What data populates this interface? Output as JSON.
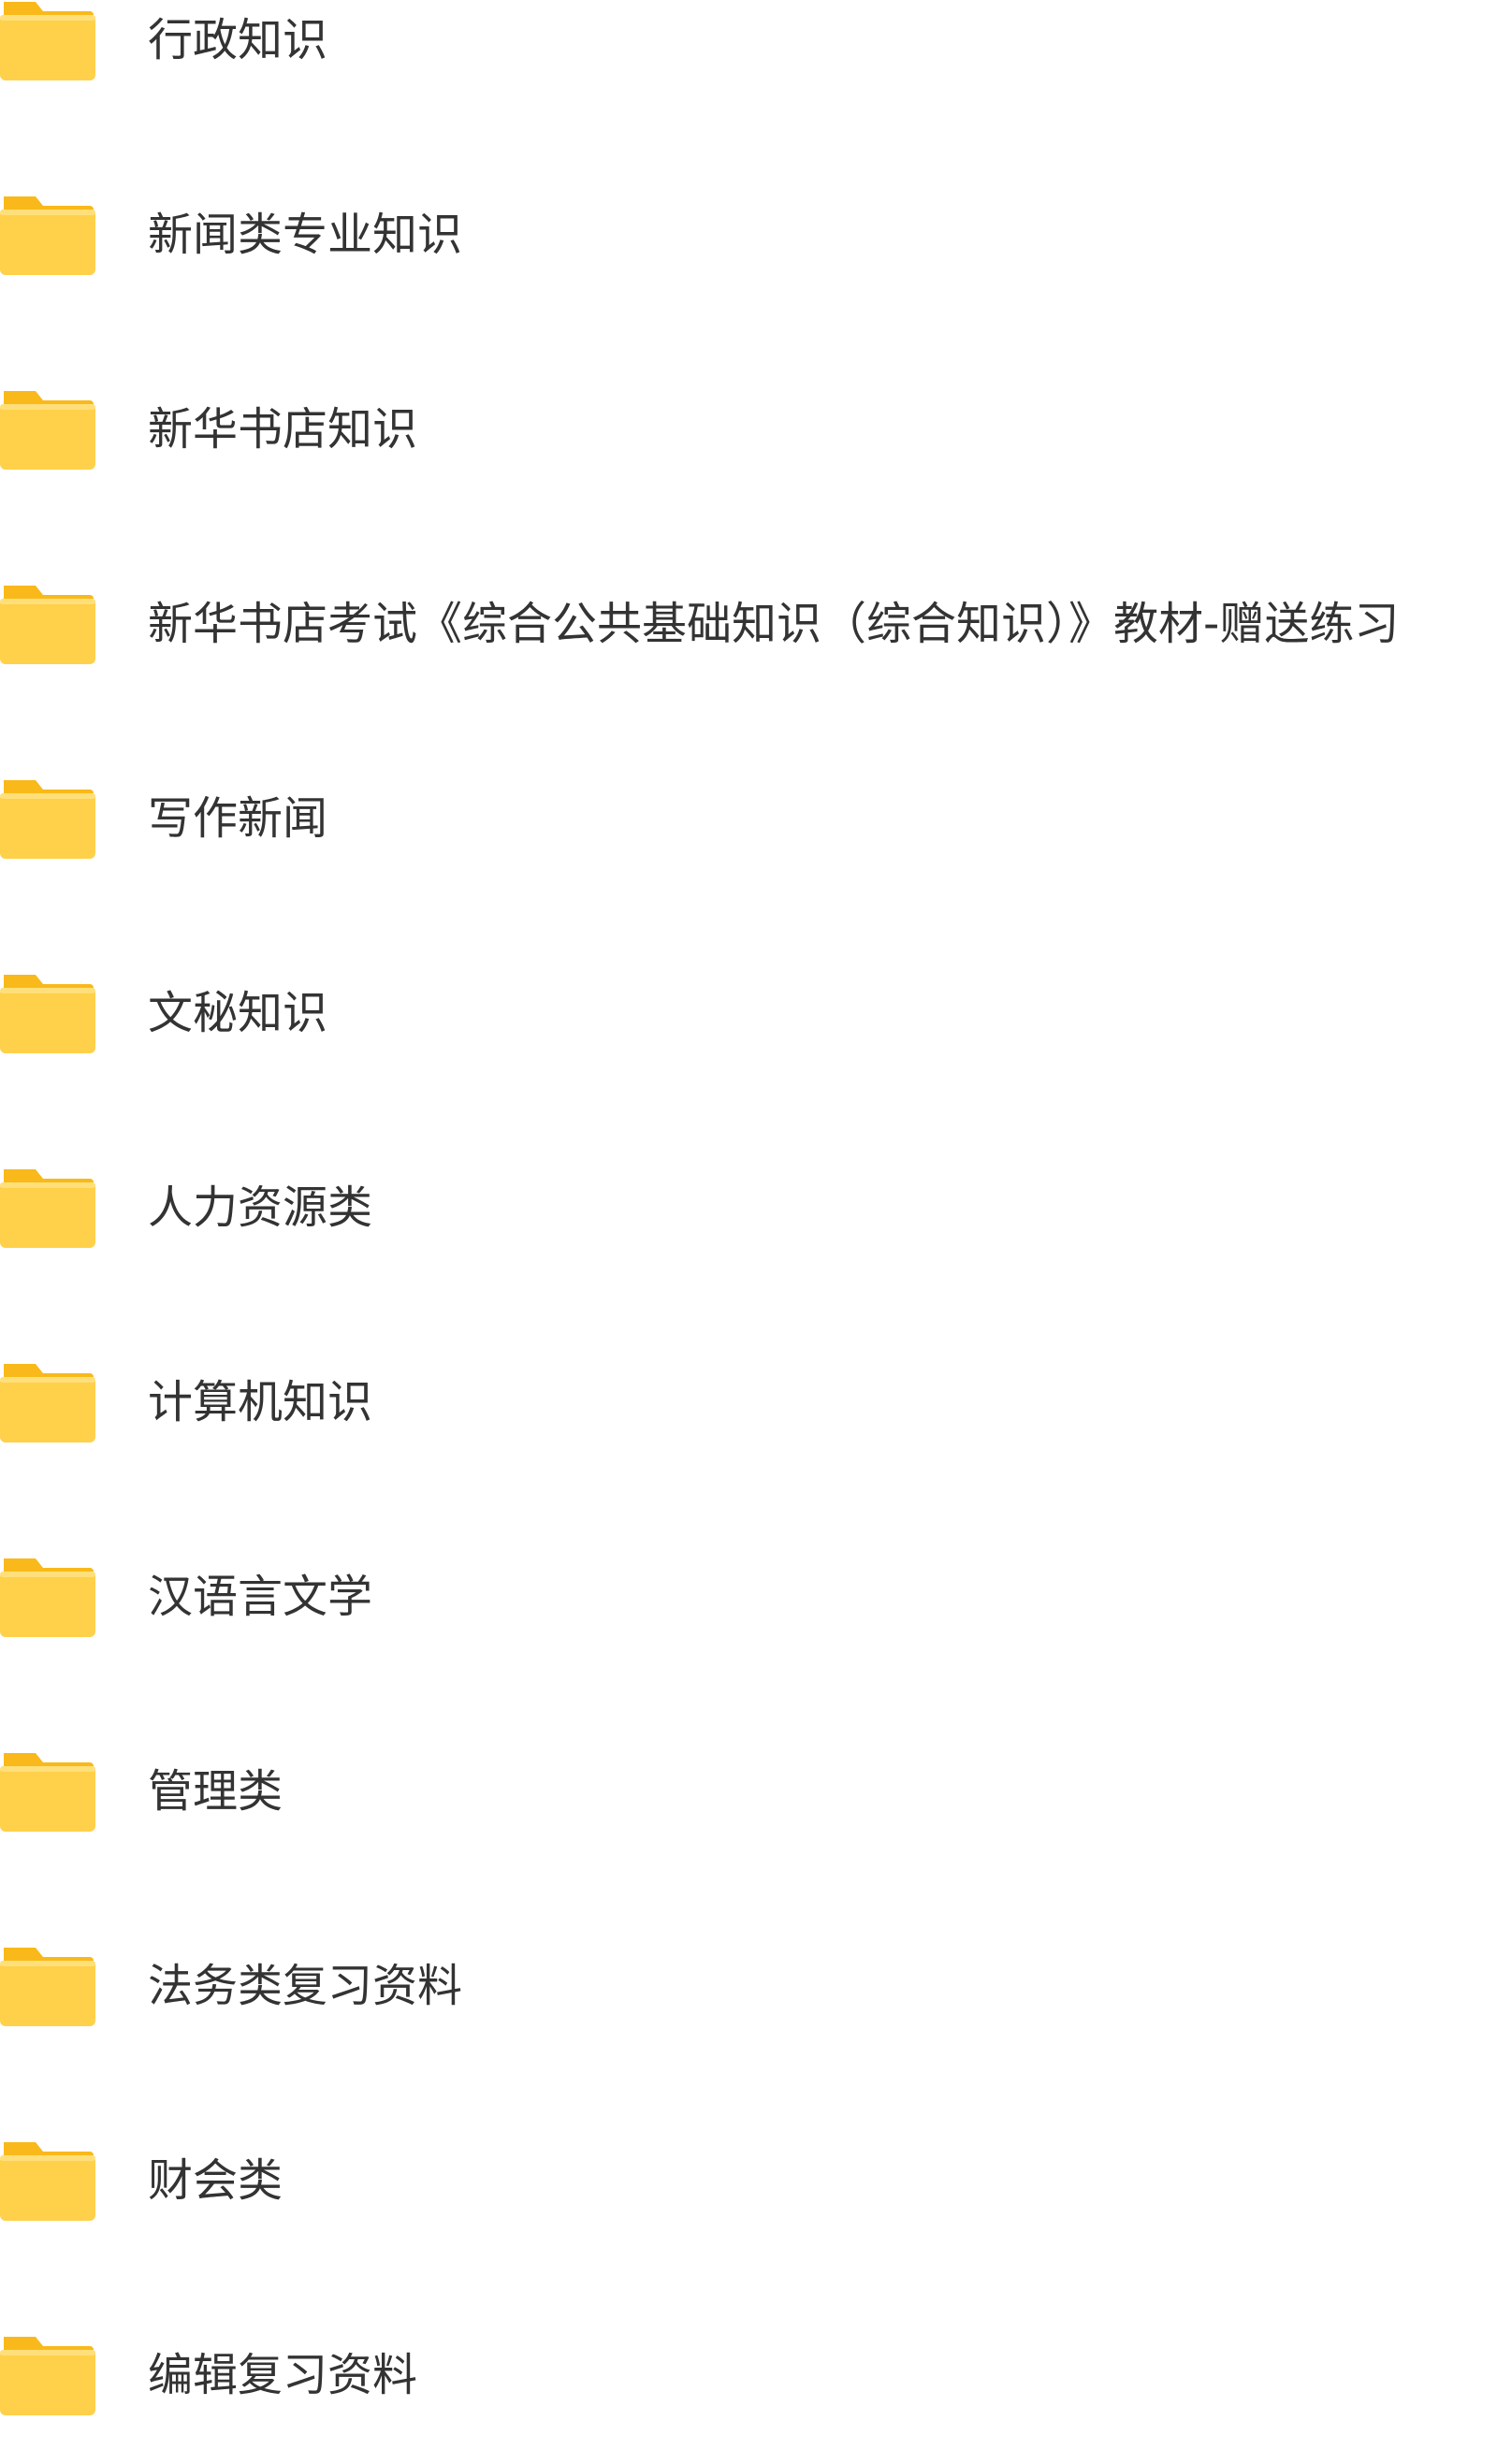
{
  "folders": [
    {
      "icon": "folder-icon",
      "name": "行政知识"
    },
    {
      "icon": "folder-icon",
      "name": "新闻类专业知识"
    },
    {
      "icon": "folder-icon",
      "name": "新华书店知识"
    },
    {
      "icon": "folder-icon",
      "name": "新华书店考试《综合公共基础知识（综合知识）》教材-赠送练习"
    },
    {
      "icon": "folder-icon",
      "name": "写作新闻"
    },
    {
      "icon": "folder-icon",
      "name": "文秘知识"
    },
    {
      "icon": "folder-icon",
      "name": "人力资源类"
    },
    {
      "icon": "folder-icon",
      "name": "计算机知识"
    },
    {
      "icon": "folder-icon",
      "name": "汉语言文学"
    },
    {
      "icon": "folder-icon",
      "name": "管理类"
    },
    {
      "icon": "folder-icon",
      "name": "法务类复习资料"
    },
    {
      "icon": "folder-icon",
      "name": "财会类"
    },
    {
      "icon": "folder-icon",
      "name": "编辑复习资料"
    }
  ],
  "colors": {
    "folder_front": "#ffd04a",
    "folder_back": "#f9b91a",
    "text": "#333333"
  }
}
